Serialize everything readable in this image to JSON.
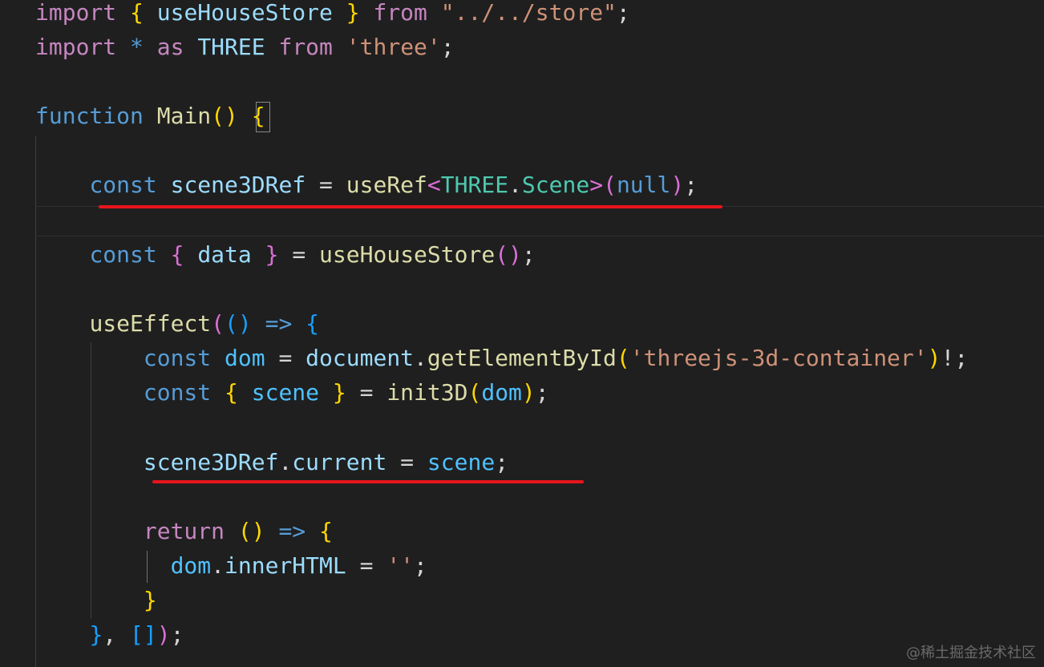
{
  "code_lines": [
    {
      "tokens": [
        {
          "text": "import",
          "cls": "kw-import"
        },
        {
          "text": " "
        },
        {
          "text": "{",
          "cls": "br1"
        },
        {
          "text": " "
        },
        {
          "text": "useHouseStore",
          "cls": "var"
        },
        {
          "text": " "
        },
        {
          "text": "}",
          "cls": "br1"
        },
        {
          "text": " "
        },
        {
          "text": "from",
          "cls": "kw-import"
        },
        {
          "text": " "
        },
        {
          "text": "\"../../store\"",
          "cls": "str"
        },
        {
          "text": ";",
          "cls": "punc"
        }
      ]
    },
    {
      "tokens": [
        {
          "text": "import",
          "cls": "kw-import"
        },
        {
          "text": " "
        },
        {
          "text": "*",
          "cls": "kw-decl"
        },
        {
          "text": " "
        },
        {
          "text": "as",
          "cls": "kw-import"
        },
        {
          "text": " "
        },
        {
          "text": "THREE",
          "cls": "var"
        },
        {
          "text": " "
        },
        {
          "text": "from",
          "cls": "kw-import"
        },
        {
          "text": " "
        },
        {
          "text": "'three'",
          "cls": "str"
        },
        {
          "text": ";",
          "cls": "punc"
        }
      ]
    },
    {
      "tokens": []
    },
    {
      "tokens": [
        {
          "text": "function",
          "cls": "kw-decl"
        },
        {
          "text": " "
        },
        {
          "text": "Main",
          "cls": "fn"
        },
        {
          "text": "()",
          "cls": "br1"
        },
        {
          "text": " "
        },
        {
          "text": "{",
          "cls": "br1"
        }
      ]
    },
    {
      "tokens": []
    },
    {
      "tokens": [
        {
          "text": "    "
        },
        {
          "text": "const",
          "cls": "kw-decl"
        },
        {
          "text": " "
        },
        {
          "text": "scene3DRef",
          "cls": "var"
        },
        {
          "text": " = ",
          "cls": "punc"
        },
        {
          "text": "useRef",
          "cls": "fn"
        },
        {
          "text": "<",
          "cls": "br2"
        },
        {
          "text": "THREE",
          "cls": "type"
        },
        {
          "text": ".",
          "cls": "punc"
        },
        {
          "text": "Scene",
          "cls": "type"
        },
        {
          "text": ">",
          "cls": "br2"
        },
        {
          "text": "(",
          "cls": "br2"
        },
        {
          "text": "null",
          "cls": "kw-decl"
        },
        {
          "text": ")",
          "cls": "br2"
        },
        {
          "text": ";",
          "cls": "punc"
        }
      ]
    },
    {
      "tokens": []
    },
    {
      "tokens": [
        {
          "text": "    "
        },
        {
          "text": "const",
          "cls": "kw-decl"
        },
        {
          "text": " "
        },
        {
          "text": "{",
          "cls": "br2"
        },
        {
          "text": " "
        },
        {
          "text": "data",
          "cls": "var"
        },
        {
          "text": " "
        },
        {
          "text": "}",
          "cls": "br2"
        },
        {
          "text": " = ",
          "cls": "punc"
        },
        {
          "text": "useHouseStore",
          "cls": "fn"
        },
        {
          "text": "()",
          "cls": "br2"
        },
        {
          "text": ";",
          "cls": "punc"
        }
      ]
    },
    {
      "tokens": []
    },
    {
      "tokens": [
        {
          "text": "    "
        },
        {
          "text": "useEffect",
          "cls": "fn"
        },
        {
          "text": "(",
          "cls": "br2"
        },
        {
          "text": "()",
          "cls": "br3"
        },
        {
          "text": " "
        },
        {
          "text": "=>",
          "cls": "kw-decl"
        },
        {
          "text": " "
        },
        {
          "text": "{",
          "cls": "br3"
        }
      ]
    },
    {
      "tokens": [
        {
          "text": "        "
        },
        {
          "text": "const",
          "cls": "kw-decl"
        },
        {
          "text": " "
        },
        {
          "text": "dom",
          "cls": "const"
        },
        {
          "text": " = ",
          "cls": "punc"
        },
        {
          "text": "document",
          "cls": "var"
        },
        {
          "text": ".",
          "cls": "punc"
        },
        {
          "text": "getElementById",
          "cls": "fn"
        },
        {
          "text": "(",
          "cls": "br1"
        },
        {
          "text": "'threejs-3d-container'",
          "cls": "str"
        },
        {
          "text": ")",
          "cls": "br1"
        },
        {
          "text": "!;",
          "cls": "punc"
        }
      ]
    },
    {
      "tokens": [
        {
          "text": "        "
        },
        {
          "text": "const",
          "cls": "kw-decl"
        },
        {
          "text": " "
        },
        {
          "text": "{",
          "cls": "br1"
        },
        {
          "text": " "
        },
        {
          "text": "scene",
          "cls": "const"
        },
        {
          "text": " "
        },
        {
          "text": "}",
          "cls": "br1"
        },
        {
          "text": " = ",
          "cls": "punc"
        },
        {
          "text": "init3D",
          "cls": "fn"
        },
        {
          "text": "(",
          "cls": "br1"
        },
        {
          "text": "dom",
          "cls": "const"
        },
        {
          "text": ")",
          "cls": "br1"
        },
        {
          "text": ";",
          "cls": "punc"
        }
      ]
    },
    {
      "tokens": []
    },
    {
      "tokens": [
        {
          "text": "        "
        },
        {
          "text": "scene3DRef",
          "cls": "var"
        },
        {
          "text": ".",
          "cls": "punc"
        },
        {
          "text": "current",
          "cls": "var"
        },
        {
          "text": " = ",
          "cls": "punc"
        },
        {
          "text": "scene",
          "cls": "const"
        },
        {
          "text": ";",
          "cls": "punc"
        }
      ]
    },
    {
      "tokens": []
    },
    {
      "tokens": [
        {
          "text": "        "
        },
        {
          "text": "return",
          "cls": "kw-import"
        },
        {
          "text": " "
        },
        {
          "text": "()",
          "cls": "br1"
        },
        {
          "text": " "
        },
        {
          "text": "=>",
          "cls": "kw-decl"
        },
        {
          "text": " "
        },
        {
          "text": "{",
          "cls": "br1"
        }
      ]
    },
    {
      "tokens": [
        {
          "text": "          "
        },
        {
          "text": "dom",
          "cls": "const"
        },
        {
          "text": ".",
          "cls": "punc"
        },
        {
          "text": "innerHTML",
          "cls": "var"
        },
        {
          "text": " = ",
          "cls": "punc"
        },
        {
          "text": "''",
          "cls": "str"
        },
        {
          "text": ";",
          "cls": "punc"
        }
      ]
    },
    {
      "tokens": [
        {
          "text": "        "
        },
        {
          "text": "}",
          "cls": "br1"
        }
      ]
    },
    {
      "tokens": [
        {
          "text": "    "
        },
        {
          "text": "}",
          "cls": "br3"
        },
        {
          "text": ", ",
          "cls": "punc"
        },
        {
          "text": "[]",
          "cls": "br3"
        },
        {
          "text": ")",
          "cls": "br2"
        },
        {
          "text": ";",
          "cls": "punc"
        }
      ]
    }
  ],
  "highlights": {
    "underline_color": "#e8141c",
    "underlined_statements": [
      "const scene3DRef = useRef<THREE.Scene>(null);",
      "scene3DRef.current = scene;"
    ]
  },
  "watermark": "@稀土掘金技术社区"
}
